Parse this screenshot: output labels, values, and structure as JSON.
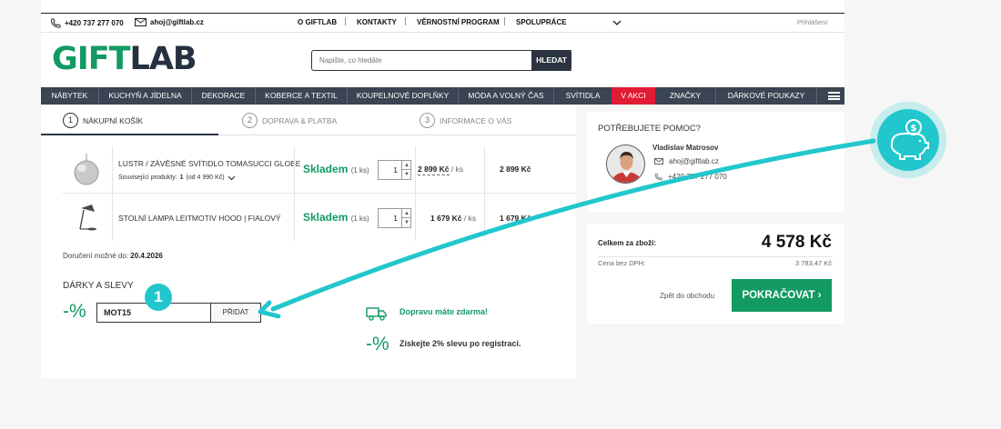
{
  "topbar": {
    "phone": "+420 737 277 070",
    "email": "ahoj@giftlab.cz",
    "links": [
      "O GIFTLAB",
      "KONTAKTY",
      "VĚRNOSTNÍ PROGRAM",
      "SPOLUPRÁCE"
    ],
    "login": "Přihlášení"
  },
  "logo": {
    "part1": "GIFT",
    "part2": "LAB"
  },
  "search": {
    "placeholder": "Napište, co hledáte",
    "button": "HLEDAT"
  },
  "nav": [
    "NÁBYTEK",
    "KUCHYŇ A JÍDELNA",
    "DEKORACE",
    "KOBERCE A TEXTIL",
    "KOUPELNOVÉ DOPLŇKY",
    "MÓDA A VOLNÝ ČAS",
    "SVÍTIDLA",
    "V AKCI",
    "ZNAČKY",
    "DÁRKOVÉ POUKAZY"
  ],
  "steps": [
    {
      "num": "1",
      "label": "NÁKUPNÍ KOŠÍK"
    },
    {
      "num": "2",
      "label": "DOPRAVA & PLATBA"
    },
    {
      "num": "3",
      "label": "INFORMACE O VÁS"
    }
  ],
  "items": [
    {
      "name": "LUSTR / ZÁVĚSNÉ SVÍTIDLO TOMASUCCI GLOBE",
      "related_prefix": "Související produkty:",
      "related_count": "1",
      "related_suffix": "(od 4 990 Kč)",
      "stock": "Skladem",
      "stock_qty": "(1 ks)",
      "qty": "1",
      "unit_price": "2 899 Kč",
      "unit": "/ ks",
      "total": "2 899 Kč"
    },
    {
      "name": "STOLNÍ LAMPA LEITMOTIV HOOD | FIALOVÝ",
      "stock": "Skladem",
      "stock_qty": "(1 ks)",
      "qty": "1",
      "unit_price": "1 679 Kč",
      "unit": "/ ks",
      "total": "1 679 Kč"
    }
  ],
  "delivery": {
    "label": "Doručení možné do:",
    "date": "20.4.2026"
  },
  "gifts": {
    "title": "DÁRKY A SLEVY",
    "percent": "-%",
    "coupon_value": "MOT15",
    "add_button": "PŘIDAT",
    "free_shipping": "Dopravu máte zdarma!",
    "register_text": "Získejte 2% slevu po registraci."
  },
  "help": {
    "title": "POTŘEBUJETE POMOC?",
    "agent": "Vladislav Matrosov",
    "email": "ahoj@giftlab.cz",
    "phone": "+420 737 277 070"
  },
  "totals": {
    "label": "Celkem za zboží:",
    "amount": "4 578 Kč",
    "novat_label": "Cena bez DPH:",
    "novat_amount": "3 783,47 Kč",
    "back": "Zpět do obchodu",
    "continue": "POKRAČOVAT"
  },
  "annotation": {
    "badge": "1"
  },
  "colors": {
    "brand_green": "#139a63",
    "nav_bg": "#3a4452",
    "sale_red": "#e21c34",
    "annotation_teal": "#22c7cd"
  }
}
